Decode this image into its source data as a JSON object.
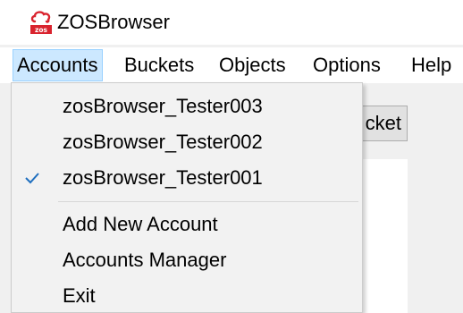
{
  "window": {
    "title": "ZOSBrowser",
    "logo_text": "zos"
  },
  "menubar": {
    "items": [
      "Accounts",
      "Buckets",
      "Objects",
      "Options",
      "Help"
    ],
    "active": "Accounts"
  },
  "background": {
    "button_partial_label": "cket"
  },
  "accounts_menu": {
    "accounts": [
      {
        "label": "zosBrowser_Tester003",
        "checked": false
      },
      {
        "label": "zosBrowser_Tester002",
        "checked": false
      },
      {
        "label": "zosBrowser_Tester001",
        "checked": true
      }
    ],
    "actions": [
      "Add New Account",
      "Accounts Manager",
      "Exit"
    ]
  },
  "colors": {
    "logo_red": "#d9232e",
    "check_blue": "#1f6fbf",
    "menu_highlight": "#cce8ff"
  },
  "icons": {
    "checked_account": "checkmark-icon",
    "app": "zos-cloud-logo-icon"
  }
}
